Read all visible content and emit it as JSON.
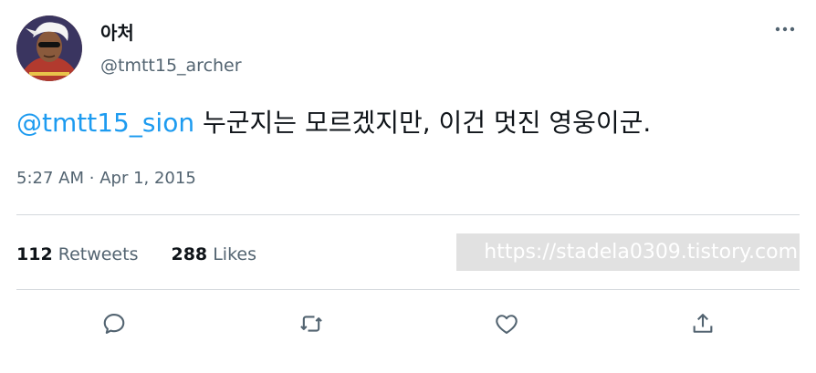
{
  "tweet": {
    "display_name": "아처",
    "handle": "@tmtt15_archer",
    "mention": "@tmtt15_sion",
    "text": "누군지는 모르겠지만, 이건 멋진 영웅이군.",
    "time": "5:27 AM",
    "separator": "·",
    "date": "Apr 1, 2015"
  },
  "stats": {
    "retweets_count": "112",
    "retweets_label": "Retweets",
    "likes_count": "288",
    "likes_label": "Likes"
  },
  "watermark": "https://stadela0309.tistory.com",
  "icons": {
    "more": "more-horizontal-icon",
    "reply": "reply-icon",
    "retweet": "retweet-icon",
    "like": "heart-icon",
    "share": "share-icon"
  },
  "colors": {
    "accent": "#1d9bf0",
    "secondary_text": "#536471",
    "primary_text": "#0f1419",
    "divider": "#d4d9dd"
  }
}
